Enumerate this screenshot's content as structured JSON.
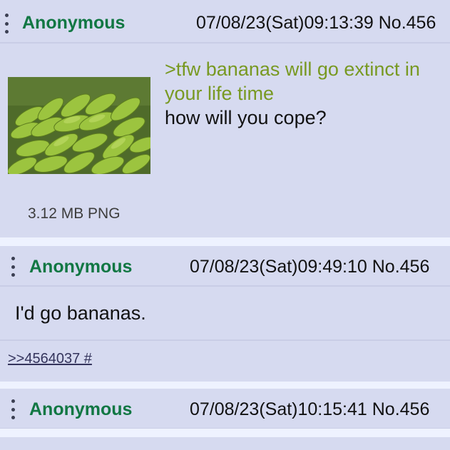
{
  "posts": [
    {
      "name": "Anonymous",
      "datetime_no": "07/08/23(Sat)09:13:39 No.456",
      "greentext": ">tfw bananas will go extinct in your life time",
      "text": "how will you cope?",
      "file_info": "3.12 MB PNG",
      "image_alt": "bananas-image"
    },
    {
      "name": "Anonymous",
      "datetime_no": "07/08/23(Sat)09:49:10 No.456",
      "text": "I'd go bananas.",
      "backlink": ">>4564037 #"
    },
    {
      "name": "Anonymous",
      "datetime_no": "07/08/23(Sat)10:15:41 No.456"
    }
  ],
  "colors": {
    "post_bg": "#d6daf0",
    "page_bg": "#eef2ff",
    "name": "#117743",
    "greentext": "#789922",
    "link": "#34345c"
  }
}
